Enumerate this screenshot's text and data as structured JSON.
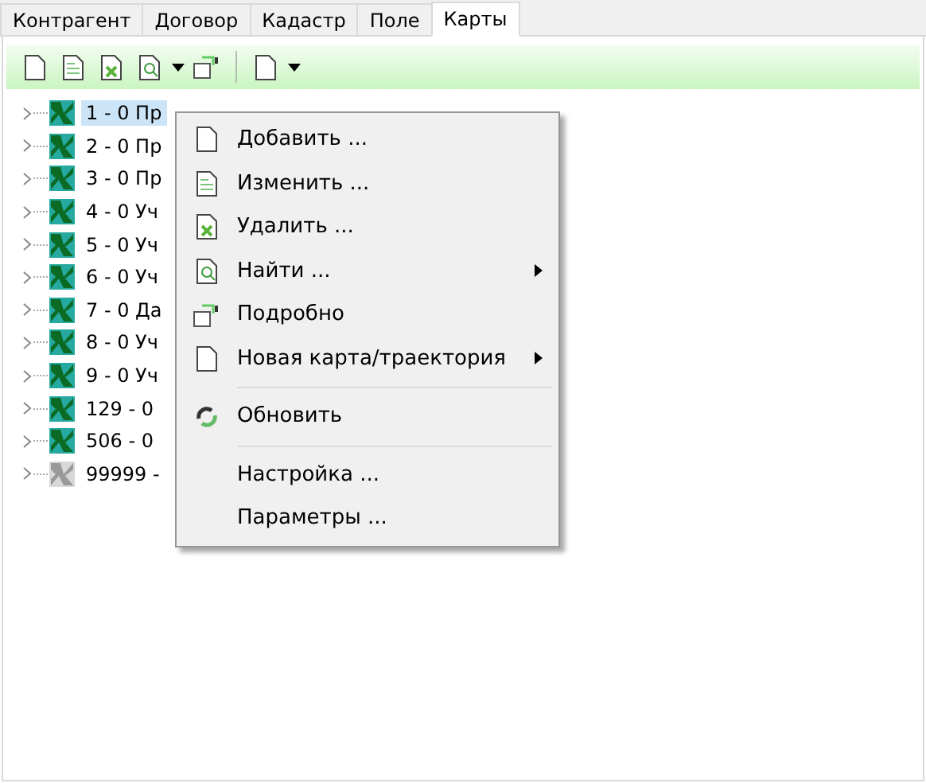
{
  "tabs": [
    {
      "label": "Контрагент",
      "selected": false
    },
    {
      "label": "Договор",
      "selected": false
    },
    {
      "label": "Кадастр",
      "selected": false
    },
    {
      "label": "Поле",
      "selected": false
    },
    {
      "label": "Карты",
      "selected": true
    }
  ],
  "tree": [
    {
      "label": "1 - 0 Пр",
      "selected": true,
      "greyed": false
    },
    {
      "label": "2 - 0 Пр",
      "selected": false,
      "greyed": false
    },
    {
      "label": "3 - 0 Пр",
      "selected": false,
      "greyed": false
    },
    {
      "label": "4 - 0 Уч",
      "selected": false,
      "greyed": false
    },
    {
      "label": "5 - 0 Уч",
      "selected": false,
      "greyed": false
    },
    {
      "label": "6 - 0 Уч",
      "selected": false,
      "greyed": false
    },
    {
      "label": "7 - 0 Да",
      "selected": false,
      "greyed": false
    },
    {
      "label": "8 - 0 Уч",
      "selected": false,
      "greyed": false
    },
    {
      "label": "9 - 0 Уч",
      "selected": false,
      "greyed": false
    },
    {
      "label": "129 - 0",
      "selected": false,
      "greyed": false
    },
    {
      "label": "506 - 0",
      "selected": false,
      "greyed": false
    },
    {
      "label": "99999 -",
      "selected": false,
      "greyed": true
    }
  ],
  "context_menu": [
    {
      "kind": "item",
      "label": "Добавить ...",
      "submenu": false
    },
    {
      "kind": "item",
      "label": "Изменить ...",
      "submenu": false
    },
    {
      "kind": "item",
      "label": "Удалить ...",
      "submenu": false
    },
    {
      "kind": "item",
      "label": "Найти ...",
      "submenu": true
    },
    {
      "kind": "item",
      "label": "Подробно",
      "submenu": false
    },
    {
      "kind": "item",
      "label": "Новая карта/траектория",
      "submenu": true
    },
    {
      "kind": "separator"
    },
    {
      "kind": "item",
      "label": "Обновить",
      "submenu": false
    },
    {
      "kind": "separator"
    },
    {
      "kind": "item",
      "label": "Настройка ...",
      "submenu": false
    },
    {
      "kind": "item",
      "label": "Параметры ...",
      "submenu": false
    }
  ]
}
